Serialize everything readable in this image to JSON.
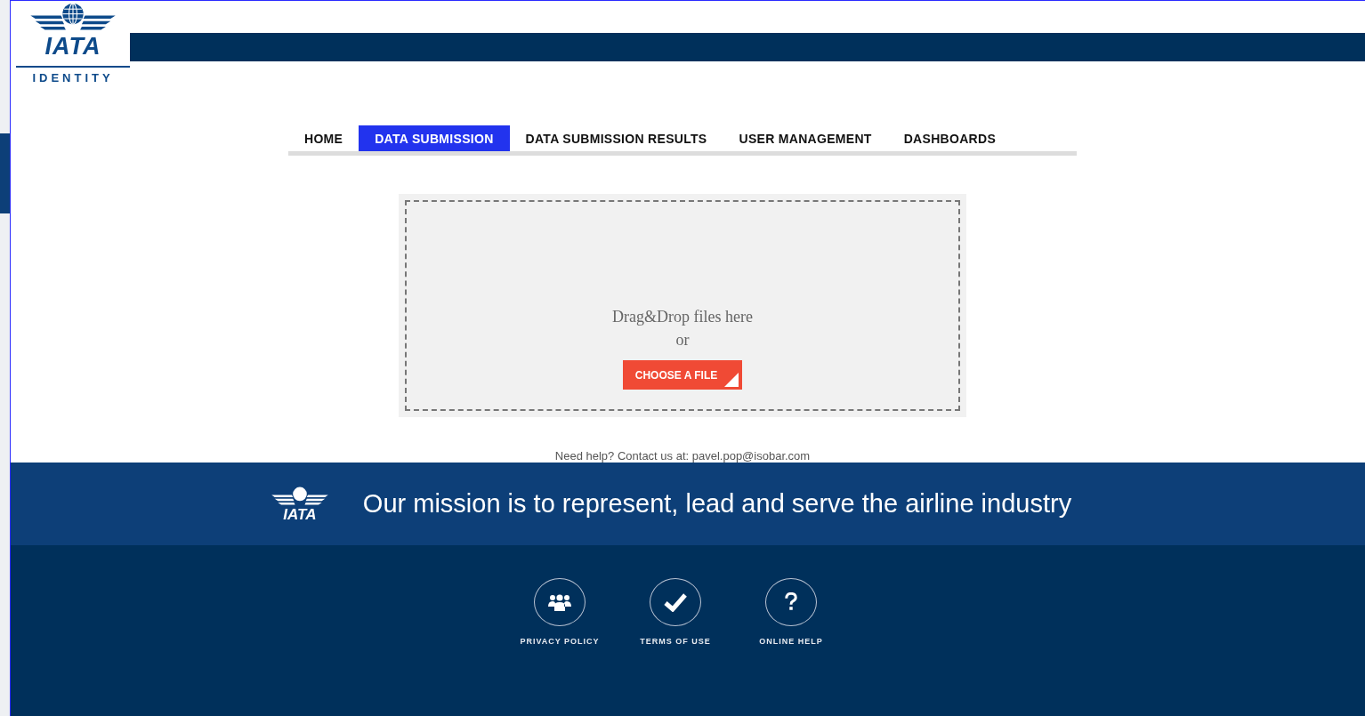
{
  "logo": {
    "wordmark": "IATA",
    "tagline": "IDENTITY"
  },
  "nav": [
    {
      "label": "HOME",
      "selected": false
    },
    {
      "label": "DATA SUBMISSION",
      "selected": true
    },
    {
      "label": "DATA SUBMISSION RESULTS",
      "selected": false
    },
    {
      "label": "USER MANAGEMENT",
      "selected": false
    },
    {
      "label": "DASHBOARDS",
      "selected": false
    }
  ],
  "dropzone": {
    "prompt": "Drag&Drop files here",
    "separator": "or",
    "button": "CHOOSE A FILE"
  },
  "help_text": "Need help? Contact us at: pavel.pop@isobar.com",
  "mission": {
    "logo_wordmark": "IATA",
    "text": "Our mission is to represent, lead and serve the airline industry"
  },
  "footer_links": [
    {
      "kind": "people",
      "label": "PRIVACY POLICY"
    },
    {
      "kind": "check",
      "label": "TERMS OF USE"
    },
    {
      "kind": "question",
      "label": "ONLINE HELP"
    }
  ]
}
